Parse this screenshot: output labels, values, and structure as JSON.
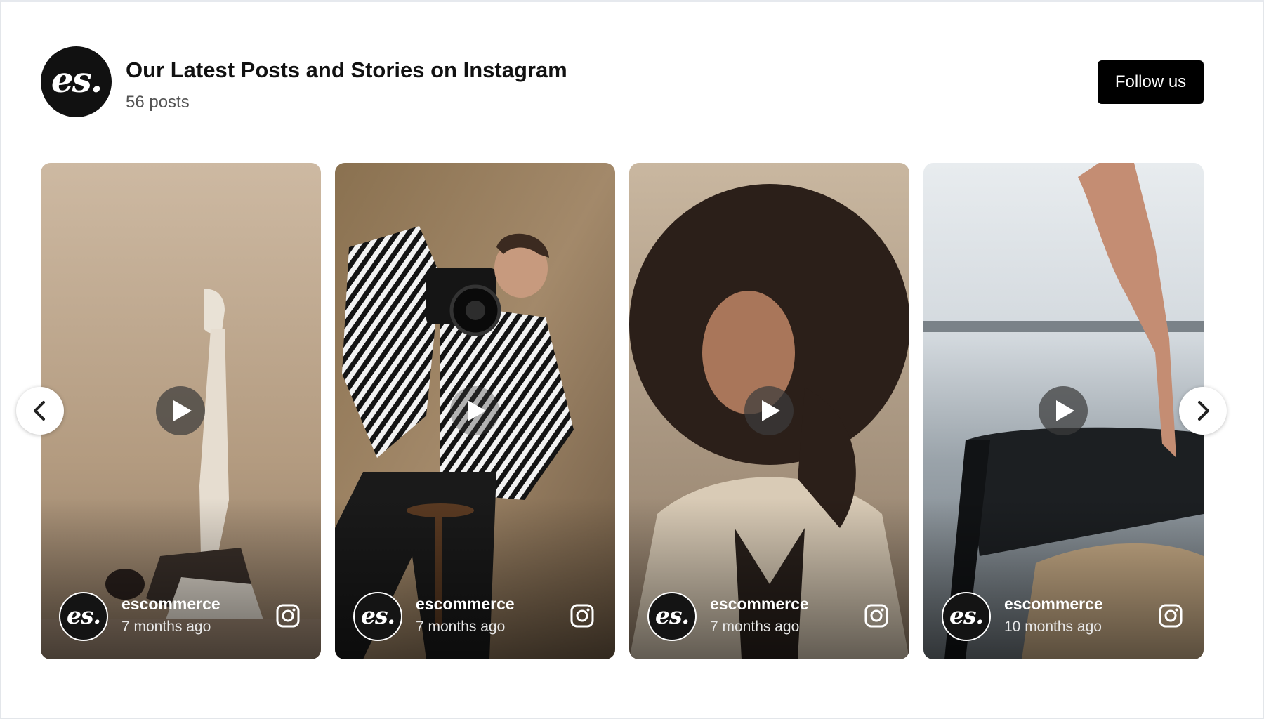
{
  "header": {
    "avatar_text": "es.",
    "title": "Our Latest Posts and Stories on Instagram",
    "post_count": "56 posts",
    "follow_label": "Follow us"
  },
  "carousel": {
    "prev_icon": "chevron-left-icon",
    "next_icon": "chevron-right-icon",
    "cards": [
      {
        "username": "escommerce",
        "time_ago": "7 months ago",
        "avatar_text": "es.",
        "icon": "instagram-icon",
        "media": "video"
      },
      {
        "username": "escommerce",
        "time_ago": "7 months ago",
        "avatar_text": "es.",
        "icon": "instagram-icon",
        "media": "video"
      },
      {
        "username": "escommerce",
        "time_ago": "7 months ago",
        "avatar_text": "es.",
        "icon": "instagram-icon",
        "media": "video"
      },
      {
        "username": "escommerce",
        "time_ago": "10 months ago",
        "avatar_text": "es.",
        "icon": "instagram-icon",
        "media": "video"
      }
    ]
  },
  "colors": {
    "button_bg": "#000000",
    "button_text": "#ffffff",
    "title_text": "#111111",
    "muted_text": "#555555"
  }
}
